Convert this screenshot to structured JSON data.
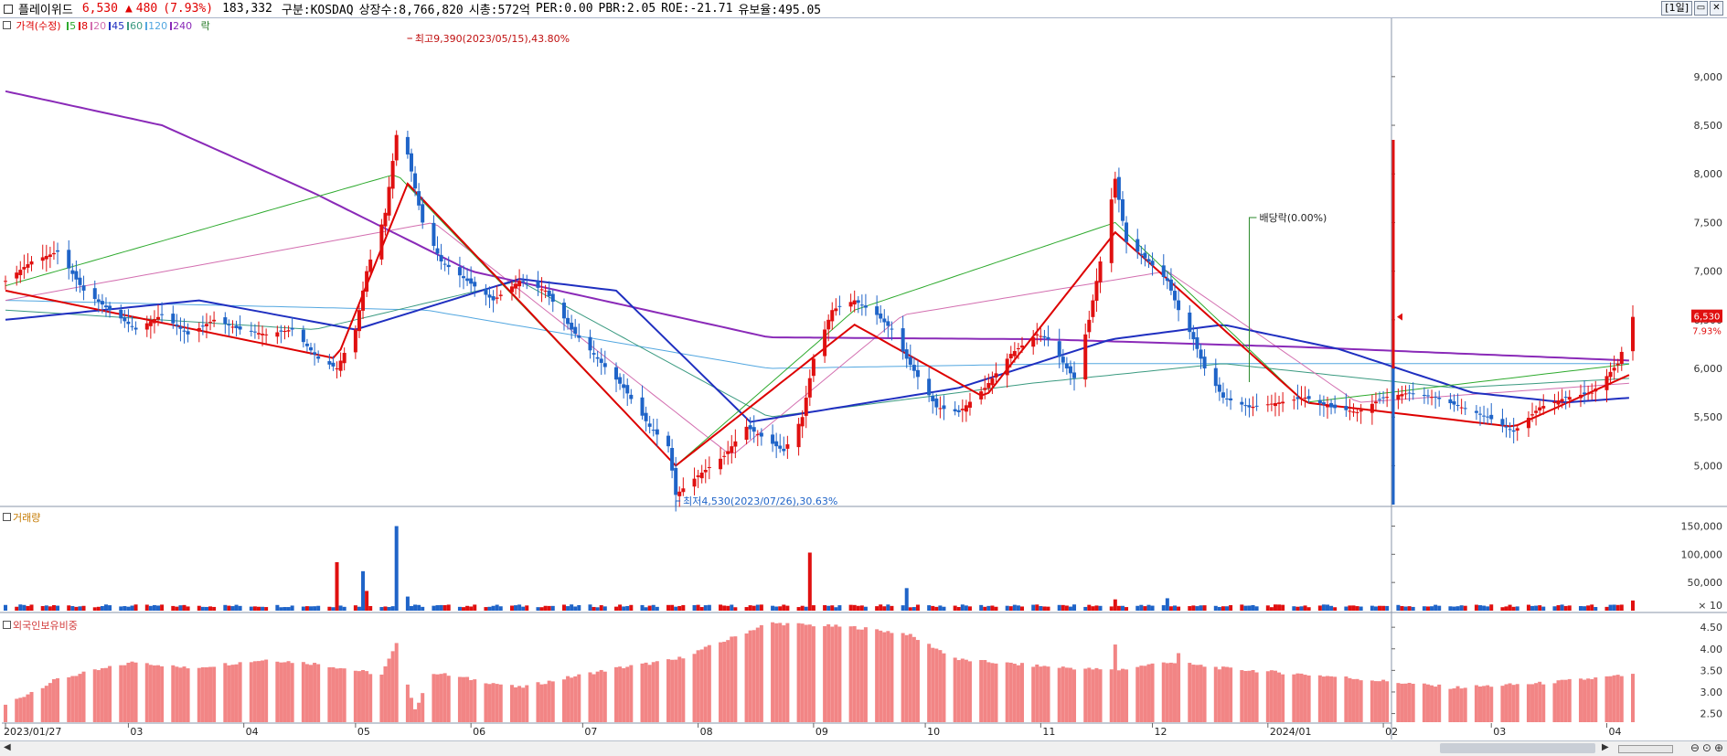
{
  "topbar": {
    "name": "플레이위드",
    "price": "6,530",
    "change_arrow": "▲",
    "change": "480",
    "change_pct": "(7.93%)",
    "volume": "183,332",
    "market": "구분:KOSDAQ",
    "shares": "상장수:8,766,820",
    "mcap": "시총:572억",
    "per": "PER:0.00",
    "pbr": "PBR:2.05",
    "roe": "ROE:-21.71",
    "retention": "유보율:495.05",
    "period": "[1일]"
  },
  "legend": {
    "price_label": "가격(수정)",
    "ma": [
      {
        "label": "5",
        "color": "#2eaa2e"
      },
      {
        "label": "8",
        "color": "#dd0000"
      },
      {
        "label": "20",
        "color": "#d36fb0"
      },
      {
        "label": "45",
        "color": "#1f2fc0"
      },
      {
        "label": "60",
        "color": "#3a9a80"
      },
      {
        "label": "120",
        "color": "#53a7e0"
      },
      {
        "label": "240",
        "color": "#8a2ab8"
      }
    ],
    "event": "락"
  },
  "annotations": {
    "high": "최고9,390(2023/05/15),43.80%",
    "low": "최저4,530(2023/07/26),30.63%",
    "dividend": "배당락(0.00%)"
  },
  "price_tag": {
    "price": "6,530",
    "pct": "7.93%"
  },
  "chart_data": [
    {
      "type": "candlestick",
      "title": "가격(수정)",
      "ylim": [
        4600,
        9600
      ],
      "yticks": [
        5000,
        5500,
        6000,
        6500,
        7000,
        7500,
        8000,
        8500,
        9000
      ],
      "ytick_labels": [
        "5,000",
        "5,500",
        "6,000",
        "6,500",
        "7,000",
        "7,500",
        "8,000",
        "8,500",
        "9,000"
      ],
      "x_labels": [
        "2023/01/27",
        "03",
        "04",
        "05",
        "06",
        "07",
        "08",
        "09",
        "10",
        "11",
        "12",
        "2024/01",
        "02",
        "03",
        "04"
      ],
      "close_keypoints": [
        [
          "2023-01-27",
          6900
        ],
        [
          "2023-02-03",
          7100
        ],
        [
          "2023-02-10",
          7200
        ],
        [
          "2023-02-17",
          6800
        ],
        [
          "2023-02-24",
          6600
        ],
        [
          "2023-03-03",
          6400
        ],
        [
          "2023-03-10",
          6550
        ],
        [
          "2023-03-17",
          6350
        ],
        [
          "2023-03-24",
          6500
        ],
        [
          "2023-03-31",
          6400
        ],
        [
          "2023-04-07",
          6350
        ],
        [
          "2023-04-14",
          6400
        ],
        [
          "2023-04-21",
          6100
        ],
        [
          "2023-04-26",
          6000
        ],
        [
          "2023-05-01",
          6400
        ],
        [
          "2023-05-04",
          7000
        ],
        [
          "2023-05-09",
          7600
        ],
        [
          "2023-05-12",
          8400
        ],
        [
          "2023-05-15",
          8200
        ],
        [
          "2023-05-19",
          7500
        ],
        [
          "2023-05-24",
          7100
        ],
        [
          "2023-05-31",
          6900
        ],
        [
          "2023-06-07",
          6700
        ],
        [
          "2023-06-14",
          6900
        ],
        [
          "2023-06-21",
          6800
        ],
        [
          "2023-06-28",
          6400
        ],
        [
          "2023-07-05",
          6100
        ],
        [
          "2023-07-12",
          5800
        ],
        [
          "2023-07-19",
          5400
        ],
        [
          "2023-07-24",
          5200
        ],
        [
          "2023-07-26",
          4700
        ],
        [
          "2023-08-01",
          4900
        ],
        [
          "2023-08-08",
          5100
        ],
        [
          "2023-08-14",
          5400
        ],
        [
          "2023-08-18",
          5300
        ],
        [
          "2023-08-24",
          5150
        ],
        [
          "2023-08-29",
          5500
        ],
        [
          "2023-09-01",
          6100
        ],
        [
          "2023-09-06",
          6600
        ],
        [
          "2023-09-12",
          6700
        ],
        [
          "2023-09-18",
          6550
        ],
        [
          "2023-09-22",
          6400
        ],
        [
          "2023-09-26",
          6100
        ],
        [
          "2023-10-04",
          5600
        ],
        [
          "2023-10-10",
          5550
        ],
        [
          "2023-10-17",
          5800
        ],
        [
          "2023-10-24",
          6150
        ],
        [
          "2023-10-31",
          6350
        ],
        [
          "2023-11-03",
          6300
        ],
        [
          "2023-11-08",
          6000
        ],
        [
          "2023-11-10",
          5900
        ],
        [
          "2023-11-14",
          6500
        ],
        [
          "2023-11-17",
          7100
        ],
        [
          "2023-11-21",
          7950
        ],
        [
          "2023-11-24",
          7300
        ],
        [
          "2023-11-30",
          7100
        ],
        [
          "2023-12-05",
          6900
        ],
        [
          "2023-12-08",
          6600
        ],
        [
          "2023-12-12",
          6300
        ],
        [
          "2023-12-15",
          6000
        ],
        [
          "2023-12-20",
          5700
        ],
        [
          "2023-12-27",
          5600
        ],
        [
          "2024-01-04",
          5650
        ],
        [
          "2024-01-11",
          5700
        ],
        [
          "2024-01-18",
          5600
        ],
        [
          "2024-01-25",
          5550
        ],
        [
          "2024-02-01",
          5700
        ],
        [
          "2024-02-08",
          5750
        ],
        [
          "2024-02-15",
          5700
        ],
        [
          "2024-02-22",
          5600
        ],
        [
          "2024-02-29",
          5500
        ],
        [
          "2024-03-07",
          5350
        ],
        [
          "2024-03-14",
          5600
        ],
        [
          "2024-03-21",
          5700
        ],
        [
          "2024-03-28",
          5750
        ],
        [
          "2024-04-04",
          6050
        ],
        [
          "2024-04-08",
          6530
        ]
      ],
      "moving_averages": {
        "5": [
          [
            "2023-01-27",
            6850
          ],
          [
            "2023-05-12",
            8000
          ],
          [
            "2023-07-26",
            5000
          ],
          [
            "2023-09-12",
            6600
          ],
          [
            "2023-11-21",
            7500
          ],
          [
            "2024-01-11",
            5650
          ],
          [
            "2024-04-08",
            6050
          ]
        ],
        "8": [
          [
            "2023-01-27",
            6800
          ],
          [
            "2023-04-26",
            6100
          ],
          [
            "2023-05-15",
            7900
          ],
          [
            "2023-07-26",
            5000
          ],
          [
            "2023-09-12",
            6450
          ],
          [
            "2023-10-17",
            5700
          ],
          [
            "2023-11-21",
            7400
          ],
          [
            "2024-01-11",
            5650
          ],
          [
            "2024-03-07",
            5400
          ],
          [
            "2024-04-08",
            5950
          ]
        ],
        "20": [
          [
            "2023-01-27",
            6700
          ],
          [
            "2023-05-22",
            7500
          ],
          [
            "2023-08-10",
            5100
          ],
          [
            "2023-09-25",
            6550
          ],
          [
            "2023-12-05",
            7000
          ],
          [
            "2024-01-25",
            5650
          ],
          [
            "2024-04-08",
            5850
          ]
        ],
        "45": [
          [
            "2023-01-27",
            6500
          ],
          [
            "2023-03-20",
            6700
          ],
          [
            "2023-05-01",
            6400
          ],
          [
            "2023-06-14",
            6920
          ],
          [
            "2023-07-10",
            6800
          ],
          [
            "2023-08-15",
            5450
          ],
          [
            "2023-10-10",
            5800
          ],
          [
            "2023-11-20",
            6300
          ],
          [
            "2023-12-20",
            6450
          ],
          [
            "2024-01-20",
            6200
          ],
          [
            "2024-02-25",
            5750
          ],
          [
            "2024-03-21",
            5650
          ],
          [
            "2024-04-08",
            5700
          ]
        ],
        "60": [
          [
            "2023-01-27",
            6600
          ],
          [
            "2023-04-20",
            6400
          ],
          [
            "2023-06-14",
            6900
          ],
          [
            "2023-08-20",
            5500
          ],
          [
            "2023-10-30",
            5850
          ],
          [
            "2023-12-20",
            6050
          ],
          [
            "2024-02-20",
            5800
          ],
          [
            "2024-04-08",
            5900
          ]
        ],
        "120": [
          [
            "2023-01-27",
            6700
          ],
          [
            "2023-05-20",
            6600
          ],
          [
            "2023-08-20",
            6000
          ],
          [
            "2023-11-10",
            6050
          ],
          [
            "2024-01-15",
            6050
          ],
          [
            "2024-04-08",
            6050
          ]
        ],
        "240": [
          [
            "2023-01-27",
            8850
          ],
          [
            "2023-03-10",
            8500
          ],
          [
            "2023-04-20",
            7800
          ],
          [
            "2023-06-01",
            7000
          ],
          [
            "2023-08-20",
            6320
          ],
          [
            "2023-11-01",
            6300
          ],
          [
            "2024-01-10",
            6220
          ],
          [
            "2024-04-08",
            6080
          ]
        ]
      }
    },
    {
      "type": "bar",
      "title": "거래량",
      "ylim": [
        0,
        180000
      ],
      "yticks": [
        50000,
        100000,
        150000
      ],
      "ytick_labels": [
        "50,000",
        "100,000",
        "150,000"
      ],
      "unit_label": "× 10",
      "spikes": [
        [
          "2023-04-26",
          86000,
          "up"
        ],
        [
          "2023-05-03",
          70000,
          "down"
        ],
        [
          "2023-05-04",
          35000,
          "up"
        ],
        [
          "2023-05-12",
          150000,
          "down"
        ],
        [
          "2023-05-15",
          25000,
          "down"
        ],
        [
          "2023-08-31",
          103000,
          "up"
        ],
        [
          "2023-09-26",
          40000,
          "down"
        ],
        [
          "2023-11-21",
          20000,
          "up"
        ],
        [
          "2023-12-05",
          22000,
          "down"
        ],
        [
          "2024-04-08",
          18000,
          "up"
        ]
      ],
      "baseline": 6000
    },
    {
      "type": "bar",
      "title": "외국인보유비중",
      "ylim": [
        2.3,
        4.8
      ],
      "yticks": [
        2.5,
        3.0,
        3.5,
        4.0,
        4.5
      ],
      "ytick_labels": [
        "2.50",
        "3.00",
        "3.50",
        "4.00",
        "4.50"
      ],
      "keypoints": [
        [
          "2023-01-27",
          2.7
        ],
        [
          "2023-02-10",
          3.3
        ],
        [
          "2023-03-03",
          3.7
        ],
        [
          "2023-03-17",
          3.55
        ],
        [
          "2023-04-07",
          3.75
        ],
        [
          "2023-04-21",
          3.65
        ],
        [
          "2023-05-08",
          3.4
        ],
        [
          "2023-05-12",
          4.1
        ],
        [
          "2023-05-17",
          2.6
        ],
        [
          "2023-05-22",
          3.45
        ],
        [
          "2023-06-14",
          3.1
        ],
        [
          "2023-06-28",
          3.35
        ],
        [
          "2023-07-10",
          3.55
        ],
        [
          "2023-07-26",
          3.75
        ],
        [
          "2023-08-10",
          4.25
        ],
        [
          "2023-08-20",
          4.6
        ],
        [
          "2023-09-12",
          4.5
        ],
        [
          "2023-09-26",
          4.35
        ],
        [
          "2023-10-10",
          3.75
        ],
        [
          "2023-11-01",
          3.6
        ],
        [
          "2023-11-21",
          3.5
        ],
        [
          "2023-12-05",
          3.7
        ],
        [
          "2023-12-20",
          3.55
        ],
        [
          "2024-01-20",
          3.35
        ],
        [
          "2024-02-20",
          3.1
        ],
        [
          "2024-03-14",
          3.2
        ],
        [
          "2024-04-08",
          3.4
        ]
      ],
      "extra_spikes": [
        [
          "2023-11-21",
          4.1
        ],
        [
          "2023-12-08",
          3.9
        ]
      ]
    }
  ]
}
